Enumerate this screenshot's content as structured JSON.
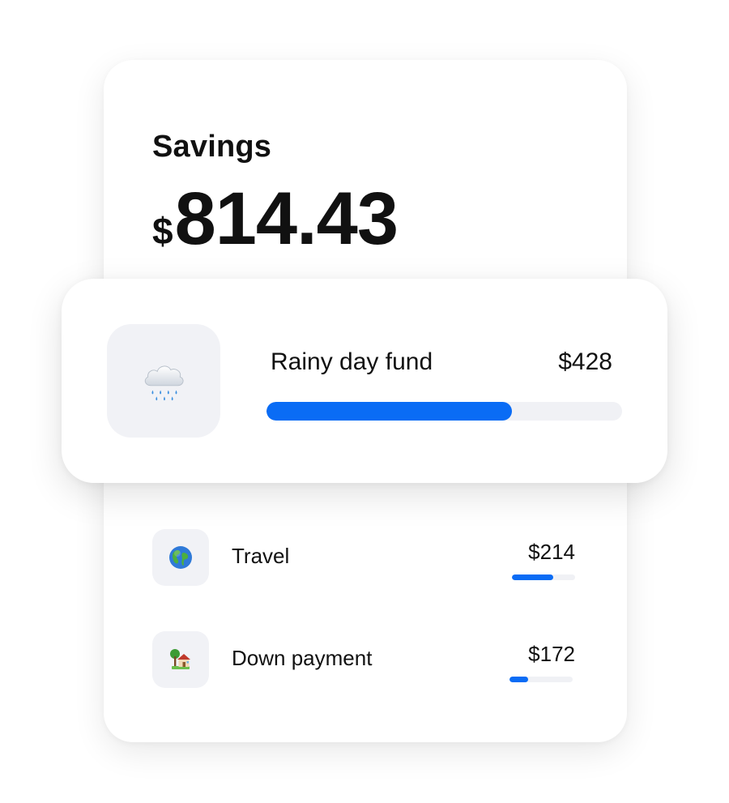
{
  "savings": {
    "title": "Savings",
    "currency_symbol": "$",
    "amount": "814.43"
  },
  "featured_goal": {
    "icon": "rain-cloud-icon",
    "name": "Rainy day fund",
    "value": "$428",
    "progress_fraction": 0.69
  },
  "goals": [
    {
      "icon": "globe-icon",
      "name": "Travel",
      "value": "$214",
      "progress_fraction": 0.66
    },
    {
      "icon": "house-icon",
      "name": "Down payment",
      "value": "$172",
      "progress_fraction": 0.3
    }
  ],
  "colors": {
    "accent": "#0a6cf5",
    "track": "#f0f1f5",
    "tile": "#f1f2f6",
    "text": "#111111"
  }
}
